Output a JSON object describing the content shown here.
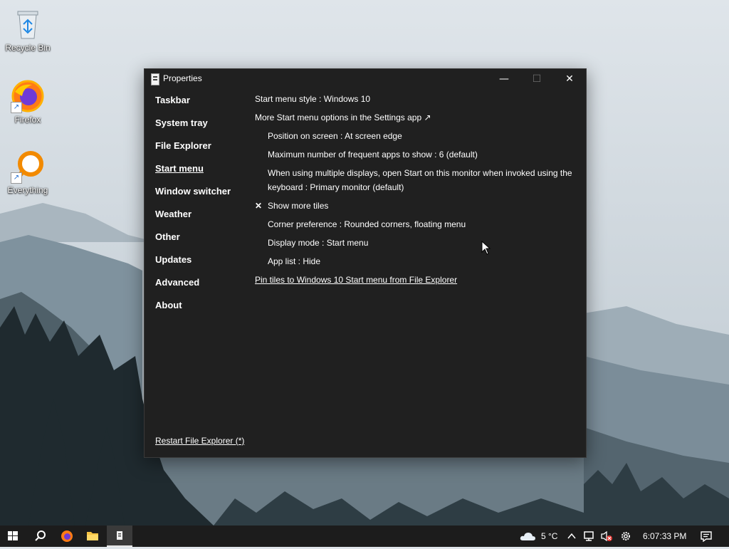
{
  "desktop": {
    "icons": [
      {
        "label": "Recycle Bin",
        "icon": "recycle-bin-icon"
      },
      {
        "label": "Firefox",
        "icon": "firefox-icon"
      },
      {
        "label": "Everything",
        "icon": "everything-search-icon"
      }
    ]
  },
  "window": {
    "title": "Properties",
    "icon": "properties-app-icon",
    "controls": {
      "minimize": "—",
      "maximize": "☐",
      "close": "✕"
    },
    "nav": {
      "items": [
        {
          "label": "Taskbar"
        },
        {
          "label": "System tray"
        },
        {
          "label": "File Explorer"
        },
        {
          "label": "Start menu"
        },
        {
          "label": "Window switcher"
        },
        {
          "label": "Weather"
        },
        {
          "label": "Other"
        },
        {
          "label": "Updates"
        },
        {
          "label": "Advanced"
        },
        {
          "label": "About"
        }
      ],
      "active": "Start menu",
      "restart_link": "Restart File Explorer (*)"
    },
    "settings": {
      "start_menu_style": "Start menu style : Windows 10",
      "more_options_link": "More Start menu options in the Settings app ↗",
      "position": "Position on screen : At screen edge",
      "max_frequent": "Maximum number of frequent apps to show : 6 (default)",
      "multi_display": "When using multiple displays, open Start on this monitor when invoked using the keyboard : Primary monitor (default)",
      "show_more_tiles": "Show more tiles",
      "show_more_tiles_check": "✕",
      "corner_pref": "Corner preference : Rounded corners, floating menu",
      "display_mode": "Display mode : Start menu",
      "app_list": "App list : Hide",
      "pin_tiles_link": "Pin tiles to Windows 10 Start menu from File Explorer"
    }
  },
  "taskbar": {
    "weather_temp": "5 °C",
    "clock": "6:07:33 PM",
    "items": [
      "start-icon",
      "search-icon",
      "firefox-icon",
      "file-explorer-icon",
      "properties-app-icon"
    ],
    "tray": [
      "weather-cloud-icon",
      "chevron-up-icon",
      "network-icon",
      "volume-muted-icon",
      "settings-gear-icon",
      "notifications-icon"
    ]
  },
  "colors": {
    "window_bg": "#202020",
    "taskbar_bg": "#1c1c1c",
    "text": "#ffffff"
  }
}
